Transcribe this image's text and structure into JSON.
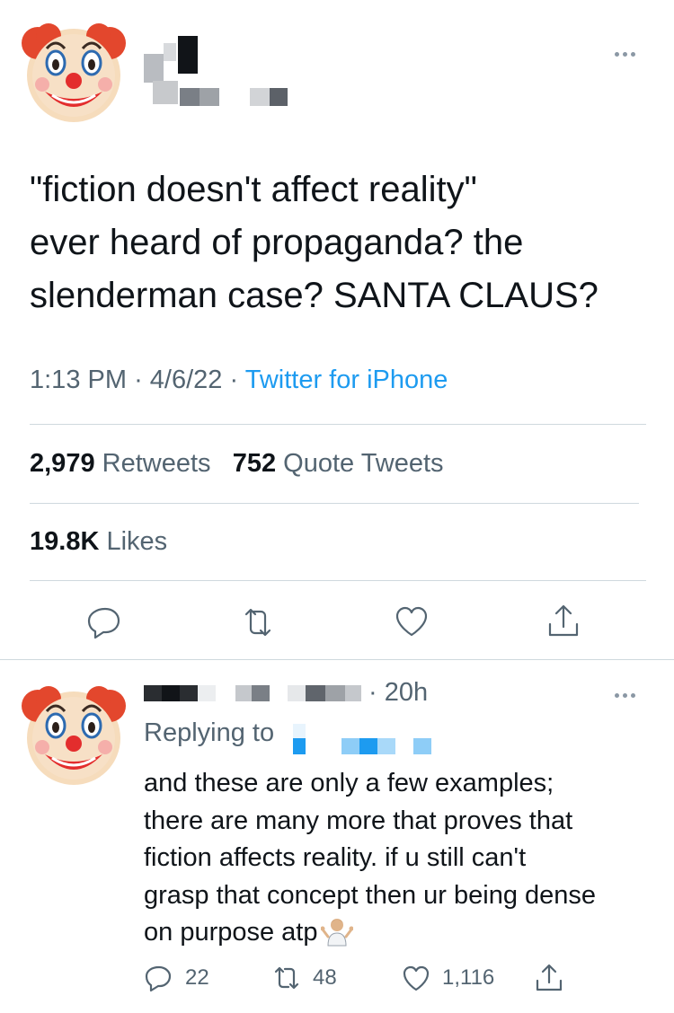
{
  "tweet": {
    "avatar_icon": "clown-face-icon",
    "text_lines": [
      "\"fiction doesn't affect reality\"",
      "ever heard of propaganda? the",
      "slenderman case? SANTA CLAUS?"
    ],
    "time": "1:13 PM",
    "separator": "·",
    "date": "4/6/22",
    "source": "Twitter for iPhone",
    "retweets_count": "2,979",
    "retweets_label": "Retweets",
    "quotes_count": "752",
    "quotes_label": "Quote Tweets",
    "likes_count": "19.8K",
    "likes_label": "Likes"
  },
  "reply": {
    "avatar_icon": "clown-face-icon",
    "time": "· 20h",
    "replying_to": "Replying to",
    "text_lines": [
      "and these are only a few examples;",
      "there are many more that proves that",
      "fiction affects reality. if u still can't",
      "grasp that concept then ur being dense",
      "on purpose atp"
    ],
    "emoji_icon": "person-shrugging-emoji-icon",
    "reply_count": "22",
    "retweet_count": "48",
    "like_count": "1,116"
  },
  "colors": {
    "text": "#0f1419",
    "secondary": "#536471",
    "link": "#1d9bf0",
    "divider": "#cfd9de"
  }
}
